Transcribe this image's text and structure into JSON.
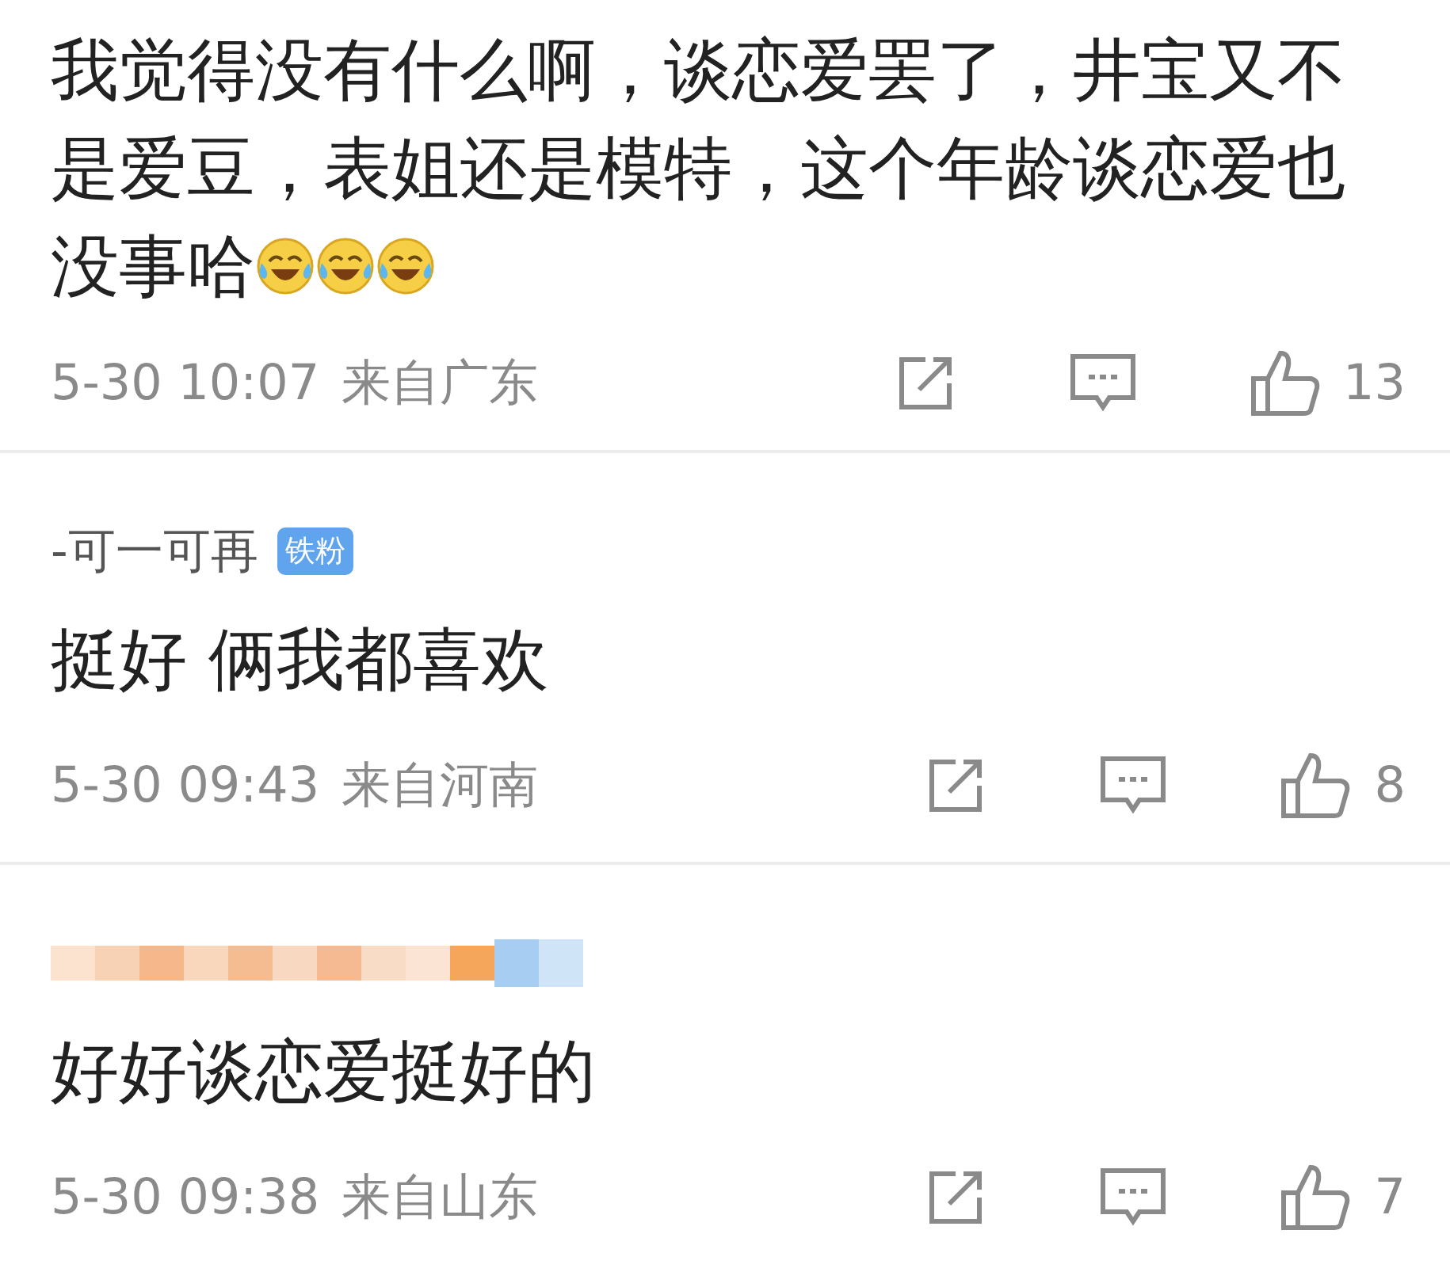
{
  "comments": [
    {
      "text": "我觉得没有什么啊，谈恋爱罢了，井宝又不是爱豆，表姐还是模特，这个年龄谈恋爱也没事哈",
      "emojis": [
        {
          "kind": "laugh_cry"
        },
        {
          "kind": "laugh_cry"
        },
        {
          "kind": "laugh_cry"
        }
      ],
      "time": "5-30 10:07",
      "location": "来自广东",
      "likes": "13"
    },
    {
      "author": "-可一可再",
      "badge": "铁粉",
      "text": "挺好 俩我都喜欢",
      "time": "5-30 09:43",
      "location": "来自河南",
      "likes": "8"
    },
    {
      "author_redacted": true,
      "text": "好好谈恋爱挺好的",
      "time": "5-30 09:38",
      "location": "来自山东",
      "likes": "7"
    }
  ]
}
